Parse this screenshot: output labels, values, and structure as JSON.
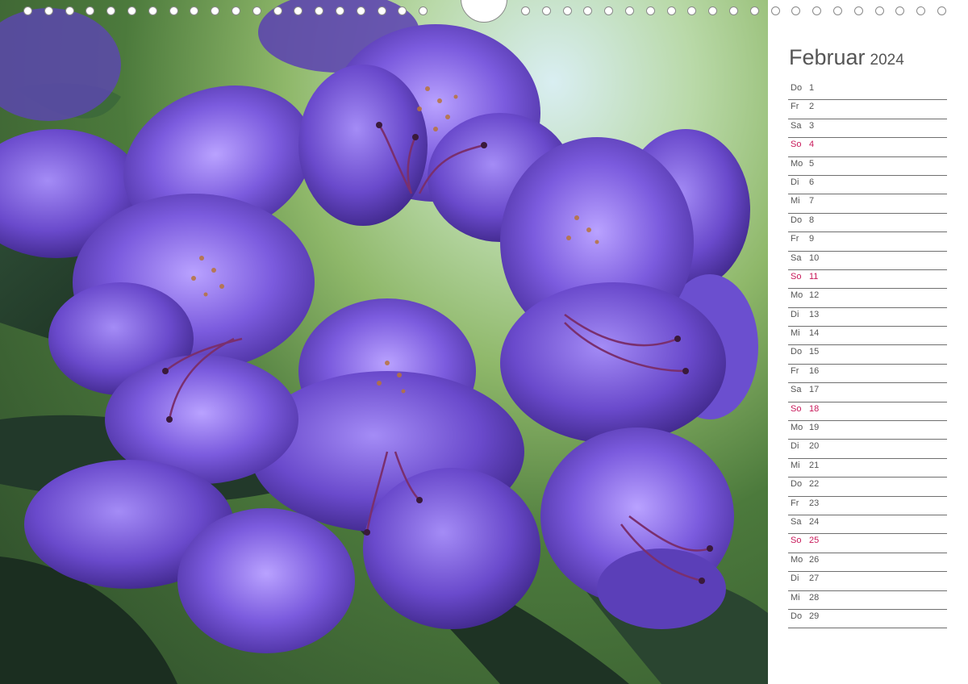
{
  "photo": {
    "subject": "purple rhododendron blossoms"
  },
  "calendar": {
    "month": "Februar",
    "year": "2024",
    "sunday_color": "#c8195a",
    "days": [
      {
        "wd": "Do",
        "d": "1"
      },
      {
        "wd": "Fr",
        "d": "2"
      },
      {
        "wd": "Sa",
        "d": "3"
      },
      {
        "wd": "So",
        "d": "4"
      },
      {
        "wd": "Mo",
        "d": "5"
      },
      {
        "wd": "Di",
        "d": "6"
      },
      {
        "wd": "Mi",
        "d": "7"
      },
      {
        "wd": "Do",
        "d": "8"
      },
      {
        "wd": "Fr",
        "d": "9"
      },
      {
        "wd": "Sa",
        "d": "10"
      },
      {
        "wd": "So",
        "d": "11"
      },
      {
        "wd": "Mo",
        "d": "12"
      },
      {
        "wd": "Di",
        "d": "13"
      },
      {
        "wd": "Mi",
        "d": "14"
      },
      {
        "wd": "Do",
        "d": "15"
      },
      {
        "wd": "Fr",
        "d": "16"
      },
      {
        "wd": "Sa",
        "d": "17"
      },
      {
        "wd": "So",
        "d": "18"
      },
      {
        "wd": "Mo",
        "d": "19"
      },
      {
        "wd": "Di",
        "d": "20"
      },
      {
        "wd": "Mi",
        "d": "21"
      },
      {
        "wd": "Do",
        "d": "22"
      },
      {
        "wd": "Fr",
        "d": "23"
      },
      {
        "wd": "Sa",
        "d": "24"
      },
      {
        "wd": "So",
        "d": "25"
      },
      {
        "wd": "Mo",
        "d": "26"
      },
      {
        "wd": "Di",
        "d": "27"
      },
      {
        "wd": "Mi",
        "d": "28"
      },
      {
        "wd": "Do",
        "d": "29"
      }
    ]
  }
}
